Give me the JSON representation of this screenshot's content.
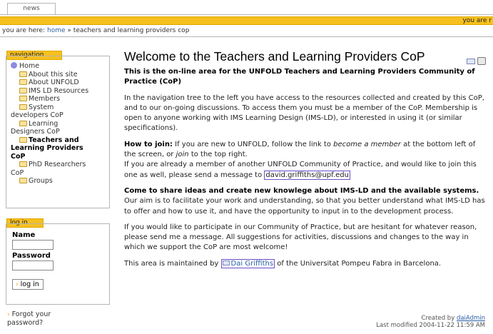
{
  "tabs": {
    "news": "news"
  },
  "personal_bar": "you are r",
  "breadcrumb": {
    "prefix": "you are here:",
    "home": "home",
    "sep": "»",
    "current": "teachers and learning providers cop"
  },
  "navigation": {
    "title": "navigation",
    "home": "Home",
    "items": [
      "About this site",
      "About UNFOLD",
      "IMS LD Resources",
      "Members",
      "System",
      "developers CoP",
      "Learning",
      "Designers CoP",
      "Teachers and",
      "Learning Providers",
      "CoP",
      "PhD Researchers",
      "CoP",
      "Groups"
    ]
  },
  "login": {
    "title": "log in",
    "name_label": "Name",
    "password_label": "Password",
    "button": "log in",
    "forgot_line1": "Forgot your",
    "forgot_line2": "password?"
  },
  "page": {
    "title": "Welcome to the Teachers and Learning Providers CoP",
    "intro": "This is the on-line area for the UNFOLD Teachers and Learning Providers Community of Practice (CoP)",
    "p1": "In the navigation tree to the left you have access to the resources collected and created by this CoP, and to our on-going discussions. To access them you must be a member of the CoP. Membership is open to anyone working with IMS Learning Design (IMS-LD), or interested in using it (or similar specifications).",
    "join_label": "How to join:",
    "join_a": "If you are new to UNFOLD, follow the link to",
    "join_em1": "become a member",
    "join_b": "at the bottom left of the screen, or",
    "join_em2": "join",
    "join_c": "to the top right.",
    "join_line2": "If you are already a member of another UNFOLD Community of Practice, and would like to join this one as well, please send a message to",
    "email": "david.griffiths@upf.edu",
    "share_label": "Come to share ideas and create new knowlege about IMS-LD and the available systems.",
    "share_text": "Our aim is to facilitate your work and understanding, so that you better understand what IMS-LD has to offer and how to use it, and have the opportunity to input in to the development process.",
    "p_participate": "If you would like to participate in our Community of Practice, but are hesitant for whatever reason, please send me a message. All suggestions for activities, discussions and changes to the way in which we support the CoP are most welcome!",
    "maint_a": "This area is maintained by",
    "maintainer": "Dai Griffiths",
    "maint_b": "of the Universitat Pompeu Fabra in Barcelona.",
    "created_label": "Created by",
    "created_by": "daiAdmin",
    "modified": "Last modified 2004-11-22 11:59 AM"
  }
}
